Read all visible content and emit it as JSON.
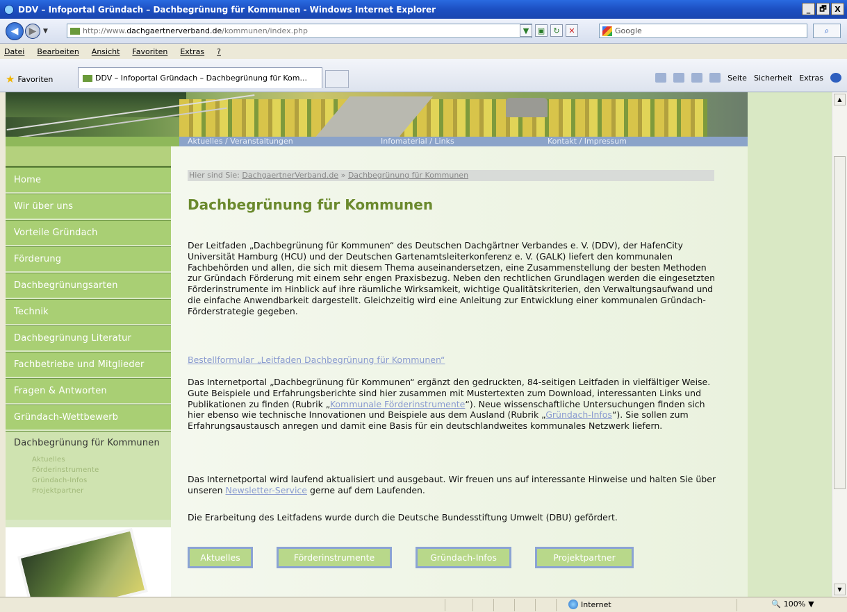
{
  "window": {
    "title": "DDV – Infoportal Gründach – Dachbegrünung für Kommunen - Windows Internet Explorer",
    "controls": [
      "_",
      "🗗",
      "X"
    ]
  },
  "address": {
    "url_prefix": "http://www.",
    "url_domain": "dachgaertnerverband.de",
    "url_path": "/kommunen/index.php",
    "search_placeholder": "Google",
    "search_go": "⌕"
  },
  "menu": [
    "Datei",
    "Bearbeiten",
    "Ansicht",
    "Favoriten",
    "Extras",
    "?"
  ],
  "favbar": {
    "favorites": "Favoriten",
    "tab_title": "DDV – Infoportal Gründach – Dachbegrünung für Kom...",
    "commands": [
      "Seite",
      "Sicherheit",
      "Extras"
    ]
  },
  "site": {
    "topnav": [
      "Aktuelles / Veranstaltungen",
      "Infomaterial / Links",
      "Kontakt / Impressum"
    ],
    "sidebar": [
      "Home",
      "Wir über uns",
      "Vorteile Gründach",
      "Förderung",
      "Dachbegrünungsarten",
      "Technik",
      "Dachbegrünung Literatur",
      "Fachbetriebe und Mitglieder",
      "Fragen & Antworten",
      "Gründach-Wettbewerb"
    ],
    "sidebar_active": {
      "label": "Dachbegrünung für Kommunen",
      "sub": [
        "Aktuelles",
        "Förderinstrumente",
        "Gründach-Infos",
        "Projektpartner"
      ]
    },
    "breadcrumb": {
      "prefix": "Hier sind Sie:",
      "home": "DachgaertnerVerband.de",
      "sep": "»",
      "current": "Dachbegrünung für Kommunen"
    },
    "heading": "Dachbegrünung für Kommunen",
    "p1": "Der Leitfaden „Dachbegrünung für Kommunen“ des Deutschen Dachgärtner Verbandes e. V. (DDV), der HafenCity Universität Hamburg (HCU) und der Deutschen Gartenamtsleiterkonferenz e. V. (GALK) liefert den kommunalen Fachbehörden und allen, die sich mit diesem Thema auseinandersetzen, eine Zusammenstellung der besten Methoden zur Gründach Förderung mit einem sehr engen Praxisbezug. Neben den rechtlichen Grundlagen werden die eingesetzten Förderinstrumente im Hinblick auf ihre räumliche Wirksamkeit, wichtige Qualitätskriterien, den Verwaltungsaufwand und die einfache Anwendbarkeit dargestellt. Gleichzeitig wird eine Anleitung zur Entwicklung einer kommunalen Gründach-Förderstrategie gegeben.",
    "order_link": "Bestellformular „Leitfaden Dachbegrünung für Kommunen“",
    "p2a": "Das Internetportal „Dachbegrünung für Kommunen“ ergänzt den gedruckten, 84-seitigen Leitfaden in vielfältiger Weise. Gute Beispiele und Erfahrungsberichte sind hier zusammen mit Mustertexten zum Download, interessanten Links und Publikationen zu finden (Rubrik „",
    "p2_link1": "Kommunale Förderinstrumente",
    "p2b": "“). Neue wissenschaftliche Untersuchungen finden sich hier ebenso wie technische Innovationen und Beispiele aus dem Ausland (Rubrik „",
    "p2_link2": "Gründach-Infos",
    "p2c": "“). Sie sollen zum Erfahrungsaustausch anregen und damit eine Basis für ein deutschlandweites kommunales Netzwerk liefern.",
    "p3a": "Das Internetportal wird laufend aktualisiert und ausgebaut. Wir freuen uns auf interessante Hinweise und halten Sie über unseren ",
    "p3_link": "Newsletter-Service",
    "p3b": " gerne auf dem Laufenden.",
    "p4": "Die Erarbeitung des Leitfadens wurde durch die Deutsche Bundesstiftung Umwelt (DBU) gefördert.",
    "buttons": [
      "Aktuelles",
      "Förderinstrumente",
      "Gründach-Infos",
      "Projektpartner"
    ]
  },
  "status": {
    "zone": "Internet",
    "zoom": "100%"
  }
}
